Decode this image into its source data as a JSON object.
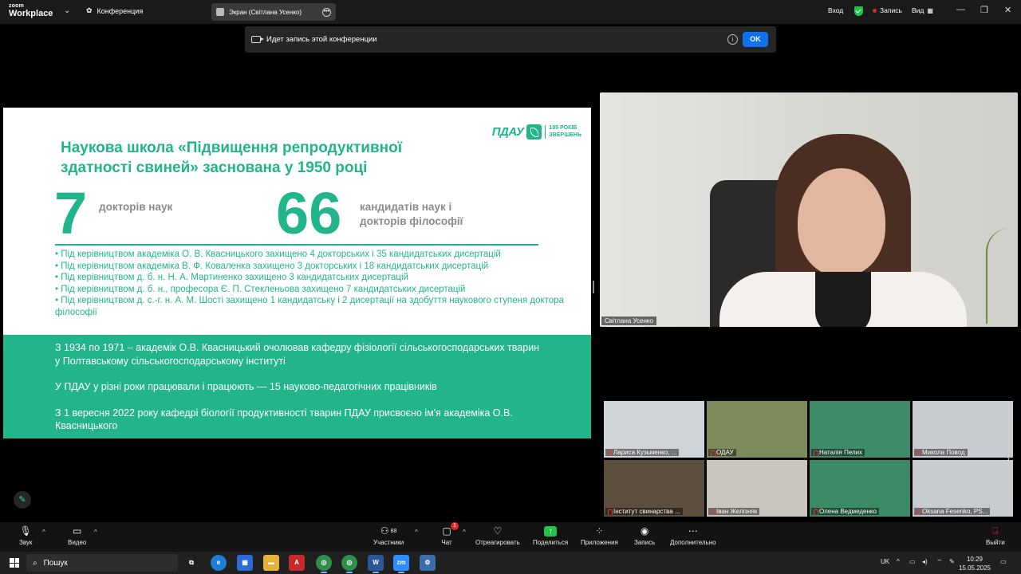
{
  "titlebar": {
    "logo_line1": "zoom",
    "logo_line2": "Workplace",
    "meeting_tab": "Конференция",
    "screen_tab": "Экран (Світлана Усенко)",
    "login": "Вход",
    "record_status": "Запись",
    "view": "Вид"
  },
  "banner": {
    "text": "Идет запись этой конференции",
    "ok": "OK"
  },
  "slide": {
    "logo_name": "ПДАУ",
    "logo_years_1": "105 РОКІВ",
    "logo_years_2": "ЗВЕРШЕНЬ",
    "title_1": "Наукова школа «Підвищення репродуктивної",
    "title_2": "здатності свиней» заснована у 1950 році",
    "stat1_value": "7",
    "stat1_label": "докторів наук",
    "stat2_value": "66",
    "stat2_label_1": "кандидатів наук і",
    "stat2_label_2": "докторів філософії",
    "bullets": [
      "• Під керівництвом академіка О. В. Квасницького захищено 4 докторських і 35  кандидатських дисертацій",
      "• Під керівництвом академіка В. Ф. Коваленка захищено 3 докторських і 18 кандидатських дисертацій",
      "• Під керівництвом д. б. н. Н. А. Мартиненко захищено 3 кандидатських дисертацій",
      "• Під керівництвом д. б. н., професора Є. П. Стекленьова захищено 7 кандидатських дисертацій",
      "• Під керівництвом д. с.-г. н. А. М. Шості захищено 1 кандидатську і 2 дисертації на здобуття наукового ступеня доктора філософії"
    ],
    "band": [
      "З 1934 по 1971 – академік О.В. Квасницький очолював кафедру фізіології сільськогосподарських тварин у Полтавському сільськогосподарському інституті",
      "У ПДАУ у різні роки працювали і працюють — 15 науково-педагогічних працівників",
      "З 1 вересня 2022 року кафедрі біології продуктивності тварин ПДАУ присвоєно ім'я академіка О.В. Квасницького"
    ]
  },
  "speaker": {
    "name": "Світлана Усенко"
  },
  "gallery": [
    {
      "name": "Лариса Кузьменко, ...",
      "bg": "#cfd4d8"
    },
    {
      "name": "ОДАУ",
      "bg": "#7d8a5c"
    },
    {
      "name": "Наталія Пелих",
      "bg": "#3e8b6a"
    },
    {
      "name": "Микола Повод",
      "bg": "#c9ccd1"
    },
    {
      "name": "Інститут свинарства ...",
      "bg": "#5c4d3c"
    },
    {
      "name": "Іван Желізняк",
      "bg": "#c9c6bf"
    },
    {
      "name": "Олена Ведмеденко",
      "bg": "#3a8a66"
    },
    {
      "name": "Oksana Fesenko, PS...",
      "bg": "#c8cbcf"
    }
  ],
  "toolbar": {
    "audio": "Звук",
    "video": "Видео",
    "participants": "Участники",
    "participants_count": "88",
    "chat": "Чат",
    "chat_badge": "1",
    "react": "Отреагировать",
    "share": "Поделиться",
    "apps": "Приложения",
    "record": "Запись",
    "more": "Дополнительно",
    "leave": "Выйти"
  },
  "taskbar": {
    "search": "Пошук",
    "lang": "UK",
    "time": "10:29",
    "date": "15.05.2025"
  },
  "colors": {
    "accent_green": "#22b58c",
    "record_red": "#e02828",
    "ok_blue": "#0e72ed"
  }
}
